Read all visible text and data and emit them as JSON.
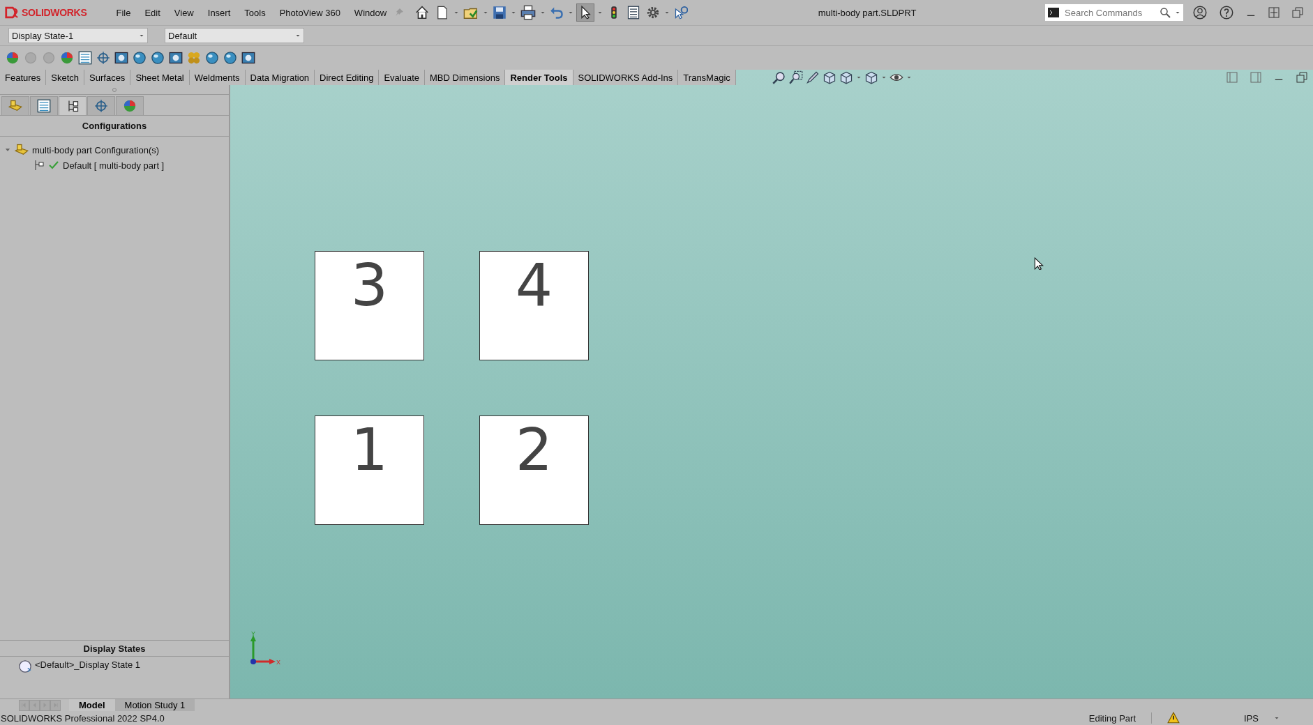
{
  "title_bar": {
    "logo": "SOLIDWORKS",
    "menus": [
      "File",
      "Edit",
      "View",
      "Insert",
      "Tools",
      "PhotoView 360",
      "Window"
    ],
    "document_title": "multi-body part.SLDPRT",
    "search": {
      "placeholder": "Search Commands"
    }
  },
  "selectors": [
    {
      "value": "Display State-1"
    },
    {
      "value": "Default"
    }
  ],
  "command_tabs": [
    {
      "label": "Features",
      "selected": false
    },
    {
      "label": "Sketch",
      "selected": false
    },
    {
      "label": "Surfaces",
      "selected": false
    },
    {
      "label": "Sheet Metal",
      "selected": false
    },
    {
      "label": "Weldments",
      "selected": false
    },
    {
      "label": "Data Migration",
      "selected": false
    },
    {
      "label": "Direct Editing",
      "selected": false
    },
    {
      "label": "Evaluate",
      "selected": false
    },
    {
      "label": "MBD Dimensions",
      "selected": false
    },
    {
      "label": "Render Tools",
      "selected": true
    },
    {
      "label": "SOLIDWORKS Add-Ins",
      "selected": false
    },
    {
      "label": "TransMagic",
      "selected": false
    }
  ],
  "panel_tabs": [
    {
      "kind": "feature",
      "selected": false
    },
    {
      "kind": "property",
      "selected": false
    },
    {
      "kind": "configuration",
      "selected": true
    },
    {
      "kind": "dimxpert",
      "selected": false
    },
    {
      "kind": "display",
      "selected": false
    }
  ],
  "configurations": {
    "title": "Configurations",
    "tree": [
      {
        "label": "multi-body part Configuration(s)",
        "expanded": true,
        "children": [
          {
            "label": "Default [ multi-body part ]",
            "active": true
          }
        ]
      }
    ]
  },
  "display_states": {
    "title": "Display States",
    "items": [
      {
        "label": "<Default>_Display State 1"
      }
    ]
  },
  "viewport": {
    "bodies": [
      {
        "label": "3"
      },
      {
        "label": "4"
      },
      {
        "label": "1"
      },
      {
        "label": "2"
      }
    ],
    "triad": {
      "x_label": "X",
      "y_label": "Y"
    }
  },
  "bottom_tabs": [
    {
      "label": "Model",
      "selected": true
    },
    {
      "label": "Motion Study 1",
      "selected": false
    }
  ],
  "status_bar": {
    "product": "SOLIDWORKS Professional 2022 SP4.0",
    "mode": "Editing Part",
    "units": "IPS"
  }
}
